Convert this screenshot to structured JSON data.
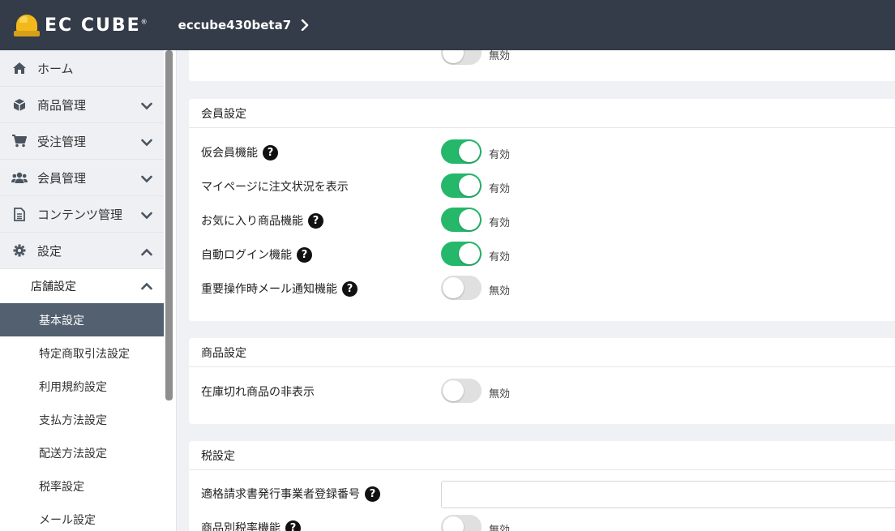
{
  "header": {
    "logo_text": "EC CUBE",
    "shop_name": "eccube430beta7"
  },
  "sidebar": {
    "items": [
      {
        "label": "ホーム",
        "icon": "home-icon"
      },
      {
        "label": "商品管理",
        "icon": "cube-icon"
      },
      {
        "label": "受注管理",
        "icon": "cart-icon"
      },
      {
        "label": "会員管理",
        "icon": "users-icon"
      },
      {
        "label": "コンテンツ管理",
        "icon": "file-icon"
      },
      {
        "label": "設定",
        "icon": "gear-icon"
      }
    ],
    "submenu_title": "店舗設定",
    "submenu": [
      {
        "label": "基本設定",
        "active": true
      },
      {
        "label": "特定商取引法設定"
      },
      {
        "label": "利用規約設定"
      },
      {
        "label": "支払方法設定"
      },
      {
        "label": "配送方法設定"
      },
      {
        "label": "税率設定"
      },
      {
        "label": "メール設定"
      }
    ]
  },
  "toggle_text": {
    "on": "有効",
    "off": "無効"
  },
  "top_partial": {
    "state": "無効"
  },
  "member_settings": {
    "title": "会員設定",
    "rows": [
      {
        "label": "仮会員機能",
        "help": true,
        "enabled": true,
        "state": "有効"
      },
      {
        "label": "マイページに注文状況を表示",
        "help": false,
        "enabled": true,
        "state": "有効"
      },
      {
        "label": "お気に入り商品機能",
        "help": true,
        "enabled": true,
        "state": "有効"
      },
      {
        "label": "自動ログイン機能",
        "help": true,
        "enabled": true,
        "state": "有効"
      },
      {
        "label": "重要操作時メール通知機能",
        "help": true,
        "enabled": false,
        "state": "無効"
      }
    ]
  },
  "product_settings": {
    "title": "商品設定",
    "rows": [
      {
        "label": "在庫切れ商品の非表示",
        "enabled": false,
        "state": "無効"
      }
    ]
  },
  "tax_settings": {
    "title": "税設定",
    "invoice_label": "適格請求書発行事業者登録番号",
    "invoice_value": "",
    "product_tax_label": "商品別税率機能",
    "product_tax_state": "無効"
  },
  "colors": {
    "header_bg": "#333c48",
    "toggle_on": "#25b86b",
    "active_item": "#52606f"
  }
}
